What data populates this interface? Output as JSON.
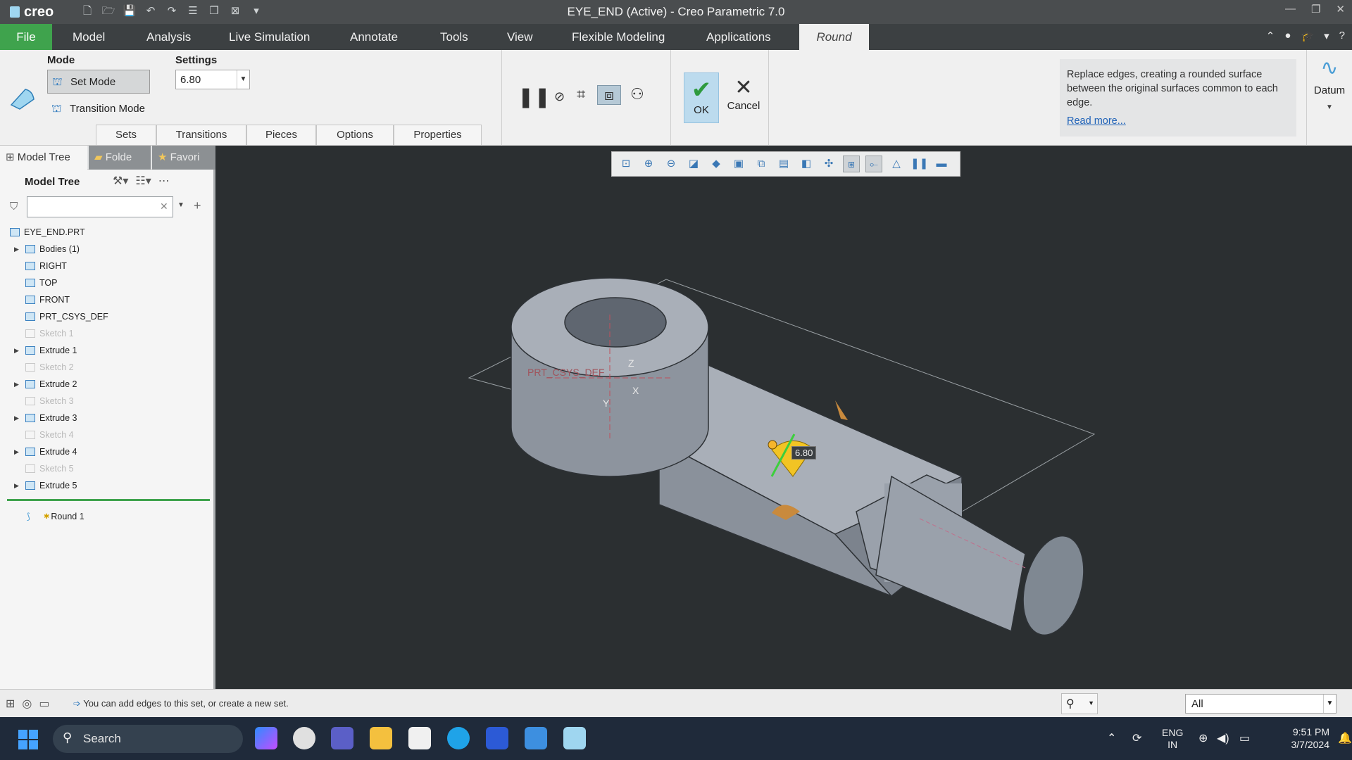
{
  "titlebar": {
    "logo": "creo",
    "title": "EYE_END (Active) - Creo Parametric 7.0"
  },
  "menu": {
    "file": "File",
    "items": [
      "Model",
      "Analysis",
      "Live Simulation",
      "Annotate",
      "Tools",
      "View",
      "Flexible Modeling",
      "Applications"
    ],
    "active_tab": "Round"
  },
  "ribbon": {
    "mode_label": "Mode",
    "set_mode": "Set Mode",
    "transition_mode": "Transition Mode",
    "settings_label": "Settings",
    "radius_value": "6.80",
    "subtabs": [
      "Sets",
      "Transitions",
      "Pieces",
      "Options",
      "Properties"
    ],
    "ok": "OK",
    "cancel": "Cancel",
    "help_text": "Replace edges, creating a rounded surface between the original surfaces common to each edge.",
    "help_link": "Read more...",
    "datum": "Datum"
  },
  "left_panel": {
    "tabs": [
      "Model Tree",
      "Folde",
      "Favori"
    ],
    "header": "Model Tree",
    "search_value": "",
    "tree": [
      {
        "label": "EYE_END.PRT",
        "dim": false,
        "expandable": false,
        "indent": 0
      },
      {
        "label": "Bodies (1)",
        "dim": false,
        "expandable": true,
        "indent": 1
      },
      {
        "label": "RIGHT",
        "dim": false,
        "expandable": false,
        "indent": 1
      },
      {
        "label": "TOP",
        "dim": false,
        "expandable": false,
        "indent": 1
      },
      {
        "label": "FRONT",
        "dim": false,
        "expandable": false,
        "indent": 1
      },
      {
        "label": "PRT_CSYS_DEF",
        "dim": false,
        "expandable": false,
        "indent": 1
      },
      {
        "label": "Sketch 1",
        "dim": true,
        "expandable": false,
        "indent": 1
      },
      {
        "label": "Extrude 1",
        "dim": false,
        "expandable": true,
        "indent": 1
      },
      {
        "label": "Sketch 2",
        "dim": true,
        "expandable": false,
        "indent": 1
      },
      {
        "label": "Extrude 2",
        "dim": false,
        "expandable": true,
        "indent": 1
      },
      {
        "label": "Sketch 3",
        "dim": true,
        "expandable": false,
        "indent": 1
      },
      {
        "label": "Extrude 3",
        "dim": false,
        "expandable": true,
        "indent": 1
      },
      {
        "label": "Sketch 4",
        "dim": true,
        "expandable": false,
        "indent": 1
      },
      {
        "label": "Extrude 4",
        "dim": false,
        "expandable": true,
        "indent": 1
      },
      {
        "label": "Sketch 5",
        "dim": true,
        "expandable": false,
        "indent": 1
      },
      {
        "label": "Extrude 5",
        "dim": false,
        "expandable": true,
        "indent": 1
      }
    ],
    "active_feature": "Round 1"
  },
  "viewport": {
    "csys_label": "PRT_CSYS_DEF",
    "axis_z": "Z",
    "axis_y": "Y",
    "axis_x": "X",
    "dimension": "6.80"
  },
  "status": {
    "message": "You can add edges to this set, or create a new set.",
    "filter": "All"
  },
  "taskbar": {
    "search": "Search",
    "lang1": "ENG",
    "lang2": "IN",
    "time": "9:51 PM",
    "date": "3/7/2024"
  }
}
